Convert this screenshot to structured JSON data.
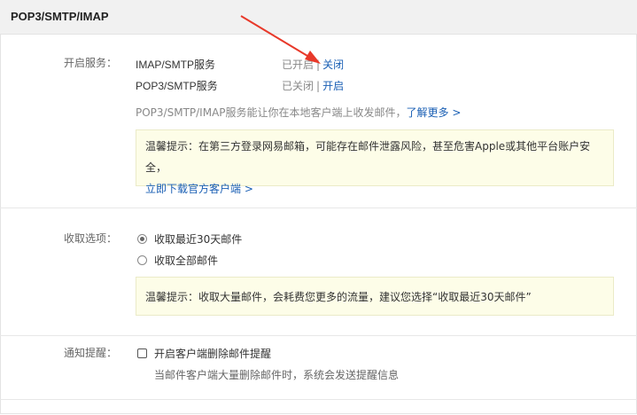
{
  "header": {
    "title": "POP3/SMTP/IMAP"
  },
  "services": {
    "label": "开启服务：",
    "items": [
      {
        "name": "IMAP/SMTP服务",
        "status": "已开启",
        "separator": "|",
        "action": "关闭"
      },
      {
        "name": "POP3/SMTP服务",
        "status": "已关闭",
        "separator": "|",
        "action": "开启"
      }
    ],
    "description": "POP3/SMTP/IMAP服务能让你在本地客户端上收发邮件，",
    "learn_more": "了解更多 >",
    "tip_text": "温馨提示：在第三方登录网易邮箱，可能存在邮件泄露风险，甚至危害Apple或其他平台账户安全，",
    "tip_link": "立即下载官方客户端 >"
  },
  "receive": {
    "label": "收取选项：",
    "options": [
      {
        "label": "收取最近30天邮件",
        "checked": true
      },
      {
        "label": "收取全部邮件",
        "checked": false
      }
    ],
    "tip_text": "温馨提示：收取大量邮件，会耗费您更多的流量，建议您选择“收取最近30天邮件”"
  },
  "notify": {
    "label": "通知提醒：",
    "checkbox_label": "开启客户端删除邮件提醒",
    "checked": false,
    "sub_description": "当邮件客户端大量删除邮件时，系统会发送提醒信息"
  },
  "colors": {
    "link": "#1a5fb4",
    "tip_bg": "#fdfde8",
    "arrow": "#e8392a"
  }
}
